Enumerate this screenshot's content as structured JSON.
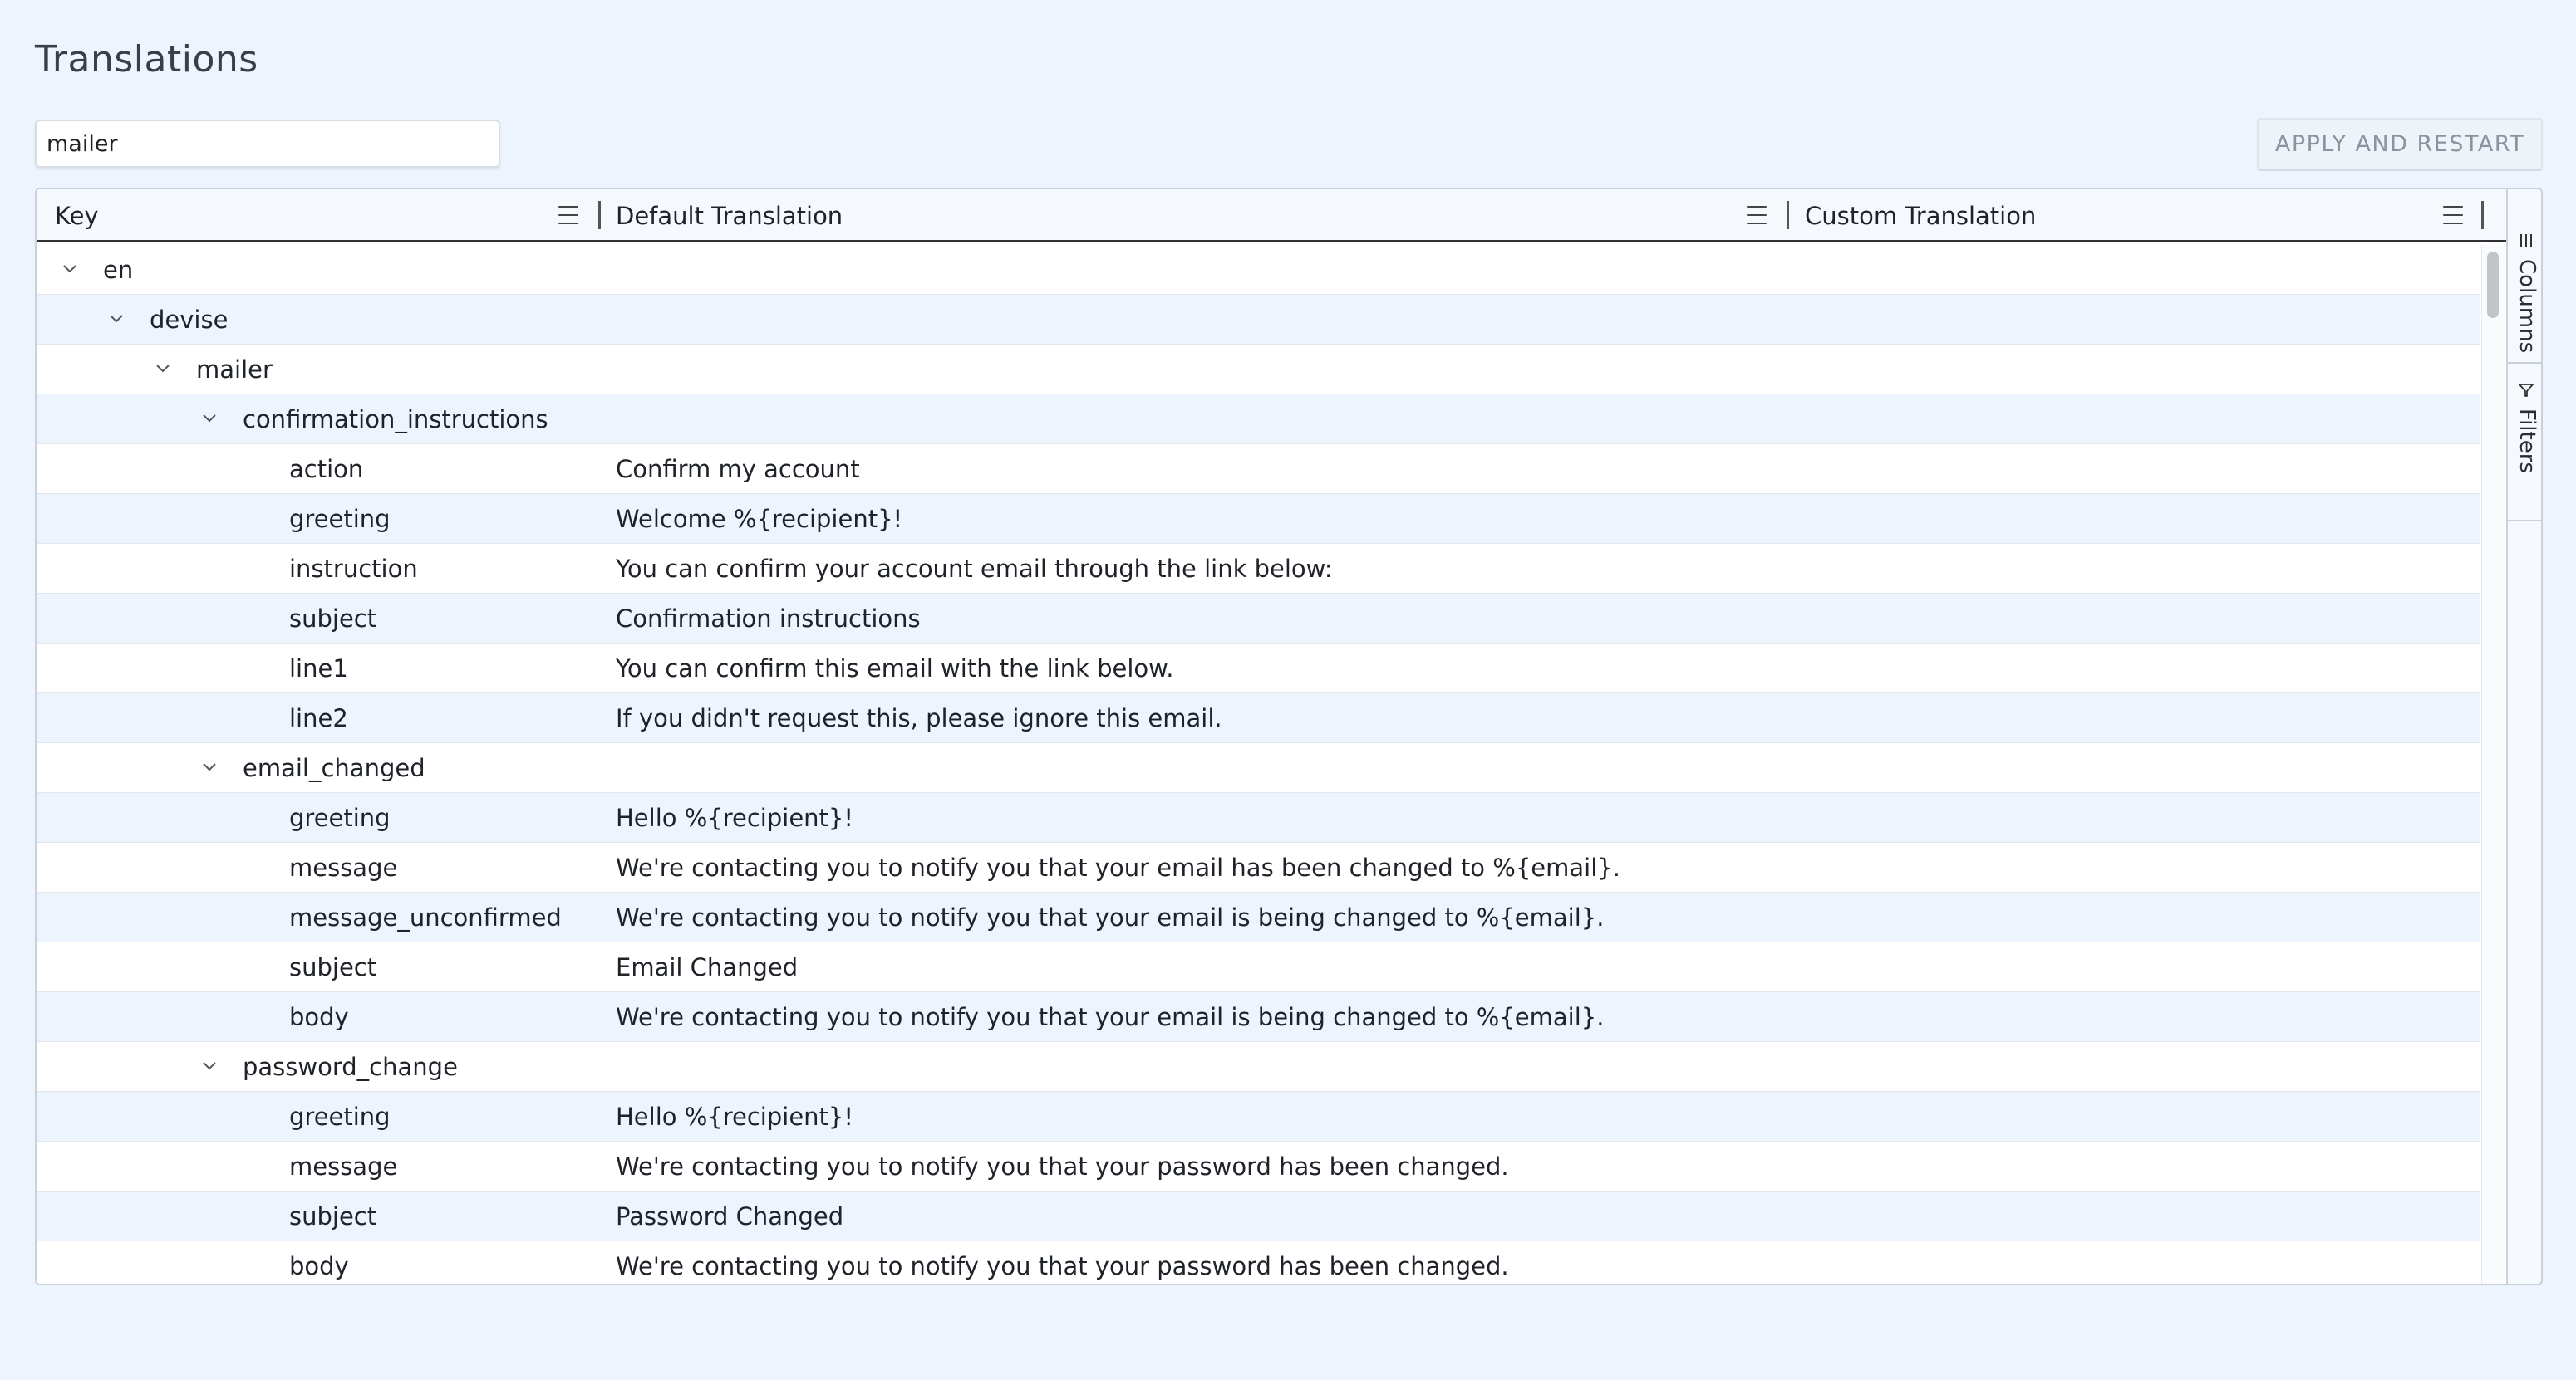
{
  "page": {
    "title": "Translations"
  },
  "toolbar": {
    "search_value": "mailer",
    "apply_label": "APPLY AND RESTART"
  },
  "columns": [
    {
      "label": "Key"
    },
    {
      "label": "Default Translation"
    },
    {
      "label": "Custom Translation"
    }
  ],
  "side_panel": {
    "columns_label": "Columns",
    "filters_label": "Filters"
  },
  "rows": [
    {
      "level": 0,
      "group": true,
      "expanded": true,
      "key": "en",
      "default": ""
    },
    {
      "level": 1,
      "group": true,
      "expanded": true,
      "key": "devise",
      "default": ""
    },
    {
      "level": 2,
      "group": true,
      "expanded": true,
      "key": "mailer",
      "default": ""
    },
    {
      "level": 3,
      "group": true,
      "expanded": true,
      "key": "confirmation_instructions",
      "default": ""
    },
    {
      "level": 4,
      "group": false,
      "key": "action",
      "default": "Confirm my account"
    },
    {
      "level": 4,
      "group": false,
      "key": "greeting",
      "default": "Welcome %{recipient}!"
    },
    {
      "level": 4,
      "group": false,
      "key": "instruction",
      "default": "You can confirm your account email through the link below:"
    },
    {
      "level": 4,
      "group": false,
      "key": "subject",
      "default": "Confirmation instructions"
    },
    {
      "level": 4,
      "group": false,
      "key": "line1",
      "default": "You can confirm this email with the link below."
    },
    {
      "level": 4,
      "group": false,
      "key": "line2",
      "default": "If you didn't request this, please ignore this email."
    },
    {
      "level": 3,
      "group": true,
      "expanded": true,
      "key": "email_changed",
      "default": ""
    },
    {
      "level": 4,
      "group": false,
      "key": "greeting",
      "default": "Hello %{recipient}!"
    },
    {
      "level": 4,
      "group": false,
      "key": "message",
      "default": "We're contacting you to notify you that your email has been changed to %{email}."
    },
    {
      "level": 4,
      "group": false,
      "key": "message_unconfirmed",
      "default": "We're contacting you to notify you that your email is being changed to %{email}."
    },
    {
      "level": 4,
      "group": false,
      "key": "subject",
      "default": "Email Changed"
    },
    {
      "level": 4,
      "group": false,
      "key": "body",
      "default": "We're contacting you to notify you that your email is being changed to %{email}."
    },
    {
      "level": 3,
      "group": true,
      "expanded": true,
      "key": "password_change",
      "default": ""
    },
    {
      "level": 4,
      "group": false,
      "key": "greeting",
      "default": "Hello %{recipient}!"
    },
    {
      "level": 4,
      "group": false,
      "key": "message",
      "default": "We're contacting you to notify you that your password has been changed."
    },
    {
      "level": 4,
      "group": false,
      "key": "subject",
      "default": "Password Changed"
    },
    {
      "level": 4,
      "group": false,
      "key": "body",
      "default": "We're contacting you to notify you that your password has been changed."
    }
  ]
}
